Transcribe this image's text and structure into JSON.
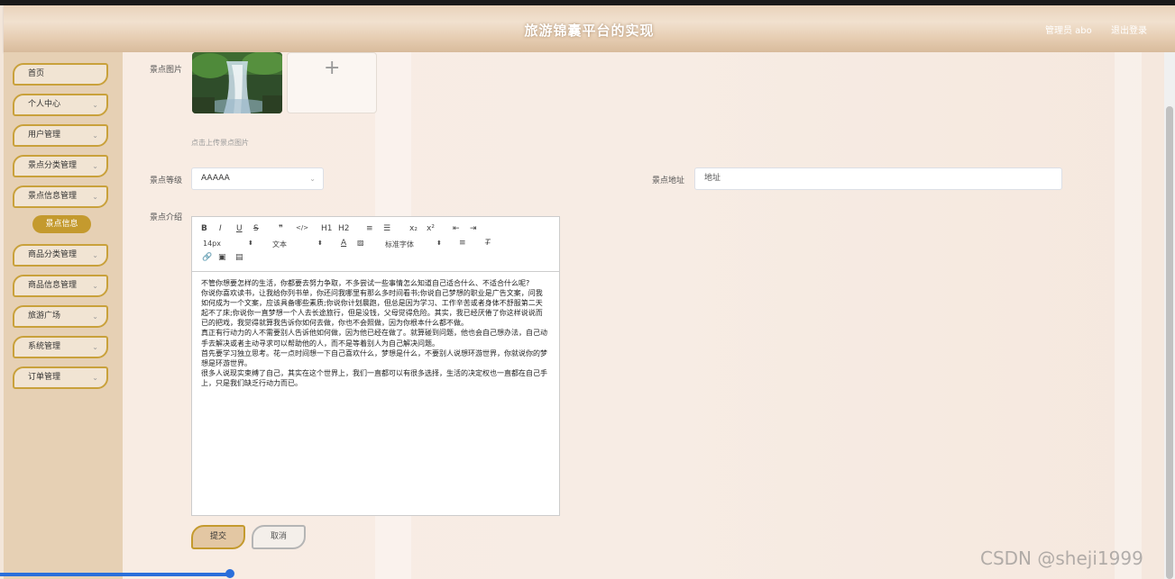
{
  "header": {
    "title": "旅游锦囊平台的实现",
    "user": "管理员 abo",
    "logout": "退出登录"
  },
  "sidebar": {
    "items": [
      {
        "label": "首页",
        "has_arrow": false
      },
      {
        "label": "个人中心",
        "has_arrow": true
      },
      {
        "label": "用户管理",
        "has_arrow": true
      },
      {
        "label": "景点分类管理",
        "has_arrow": true
      },
      {
        "label": "景点信息管理",
        "has_arrow": true
      },
      {
        "label": "商品分类管理",
        "has_arrow": true
      },
      {
        "label": "商品信息管理",
        "has_arrow": true
      },
      {
        "label": "旅游广场",
        "has_arrow": true
      },
      {
        "label": "系统管理",
        "has_arrow": true
      },
      {
        "label": "订单管理",
        "has_arrow": true
      }
    ],
    "submenu_active": "景点信息",
    "arrow_glyph": "⌄"
  },
  "form": {
    "image_label": "景点图片",
    "upload_plus": "+",
    "upload_tip": "点击上传景点图片",
    "level_label": "景点等级",
    "level_value": "AAAAA",
    "address_label": "景点地址",
    "address_placeholder": "地址",
    "intro_label": "景点介绍"
  },
  "editor": {
    "toolbar_row1": [
      "B",
      "I",
      "U",
      "S",
      "❞",
      "</>",
      "H1",
      "H2",
      "≡",
      "☰",
      "x₂",
      "x²",
      "⇤",
      "⇥"
    ],
    "size": "14px",
    "paragraph": "文本",
    "font_color": "A",
    "font": "标准字体",
    "content": [
      "不管你想要怎样的生活，你都要去努力争取，不多尝试一些事情怎么知道自己适合什么、不适合什么呢?",
      "你说你喜欢读书，让我给你列书单，你还问我哪里有那么多时间看书;你说自己梦想的职业是广告文案，问我如何成为一个文案，应该具备哪些素质;你说你计划晨跑，但总是因为学习、工作辛苦或者身体不舒服第二天起不了床;你说你一直梦想一个人去长途旅行，但是没钱，父母觉得危险。其实，我已经厌倦了你这样说说而已的把戏，我觉得就算我告诉你如何去做，你也不会照做，因为你根本什么都不做。",
      "真正有行动力的人不需要别人告诉他如何做，因为他已经在做了。就算碰到问题，他也会自己想办法，自己动手去解决或者主动寻求可以帮助他的人，而不是等着别人为自己解决问题。",
      "首先要学习独立思考。花一点时间想一下自己喜欢什么，梦想是什么，不要别人说想环游世界，你就说你的梦想是环游世界。",
      "很多人说现实束缚了自己，其实在这个世界上，我们一直都可以有很多选择，生活的决定权也一直都在自己手上，只是我们缺乏行动力而已。"
    ]
  },
  "buttons": {
    "submit": "提交",
    "cancel": "取消"
  },
  "watermark": "CSDN @sheji1999",
  "colors": {
    "accent_gold": "#c49a2e",
    "sidebar_bg": "#e6d0b4",
    "header_bg": "#e9d3bb"
  }
}
